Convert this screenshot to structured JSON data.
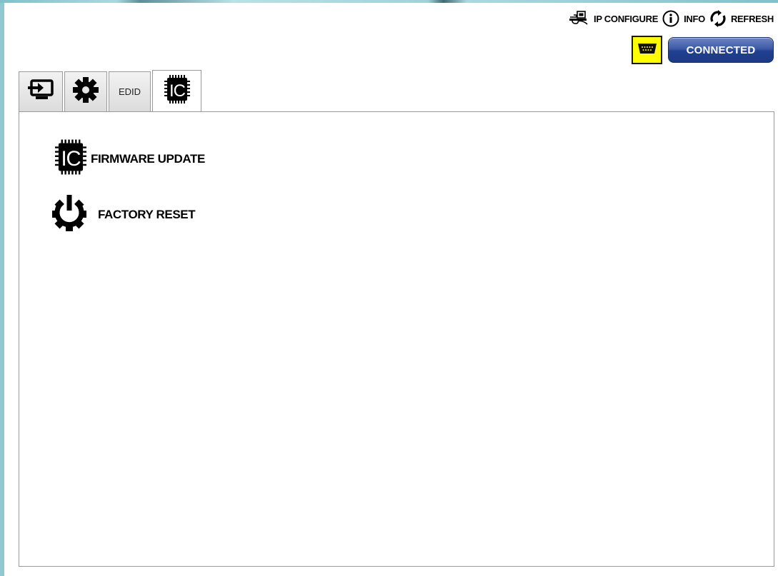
{
  "toolbar": {
    "ip_configure": {
      "label": "IP CONFIGURE",
      "icon": "network-cable-icon"
    },
    "info": {
      "label": "INFO",
      "icon": "info-icon"
    },
    "refresh": {
      "label": "REFRESH",
      "icon": "refresh-icon"
    }
  },
  "status": {
    "serial_icon": "serial-port-icon",
    "serial_highlight_color": "#ffff00",
    "connection_label": "CONNECTED",
    "connection_color": "#2a4797"
  },
  "tabs": [
    {
      "id": "input",
      "icon": "input-source-icon",
      "label": ""
    },
    {
      "id": "settings",
      "icon": "gear-icon",
      "label": ""
    },
    {
      "id": "edid",
      "icon": "",
      "label": "EDID"
    },
    {
      "id": "firmware",
      "icon": "chip-icon",
      "label": "",
      "active": true
    }
  ],
  "main": {
    "firmware_update": {
      "label": "FIRMWARE UPDATE",
      "icon": "chip-icon"
    },
    "factory_reset": {
      "label": "FACTORY RESET",
      "icon": "power-gear-icon"
    }
  }
}
